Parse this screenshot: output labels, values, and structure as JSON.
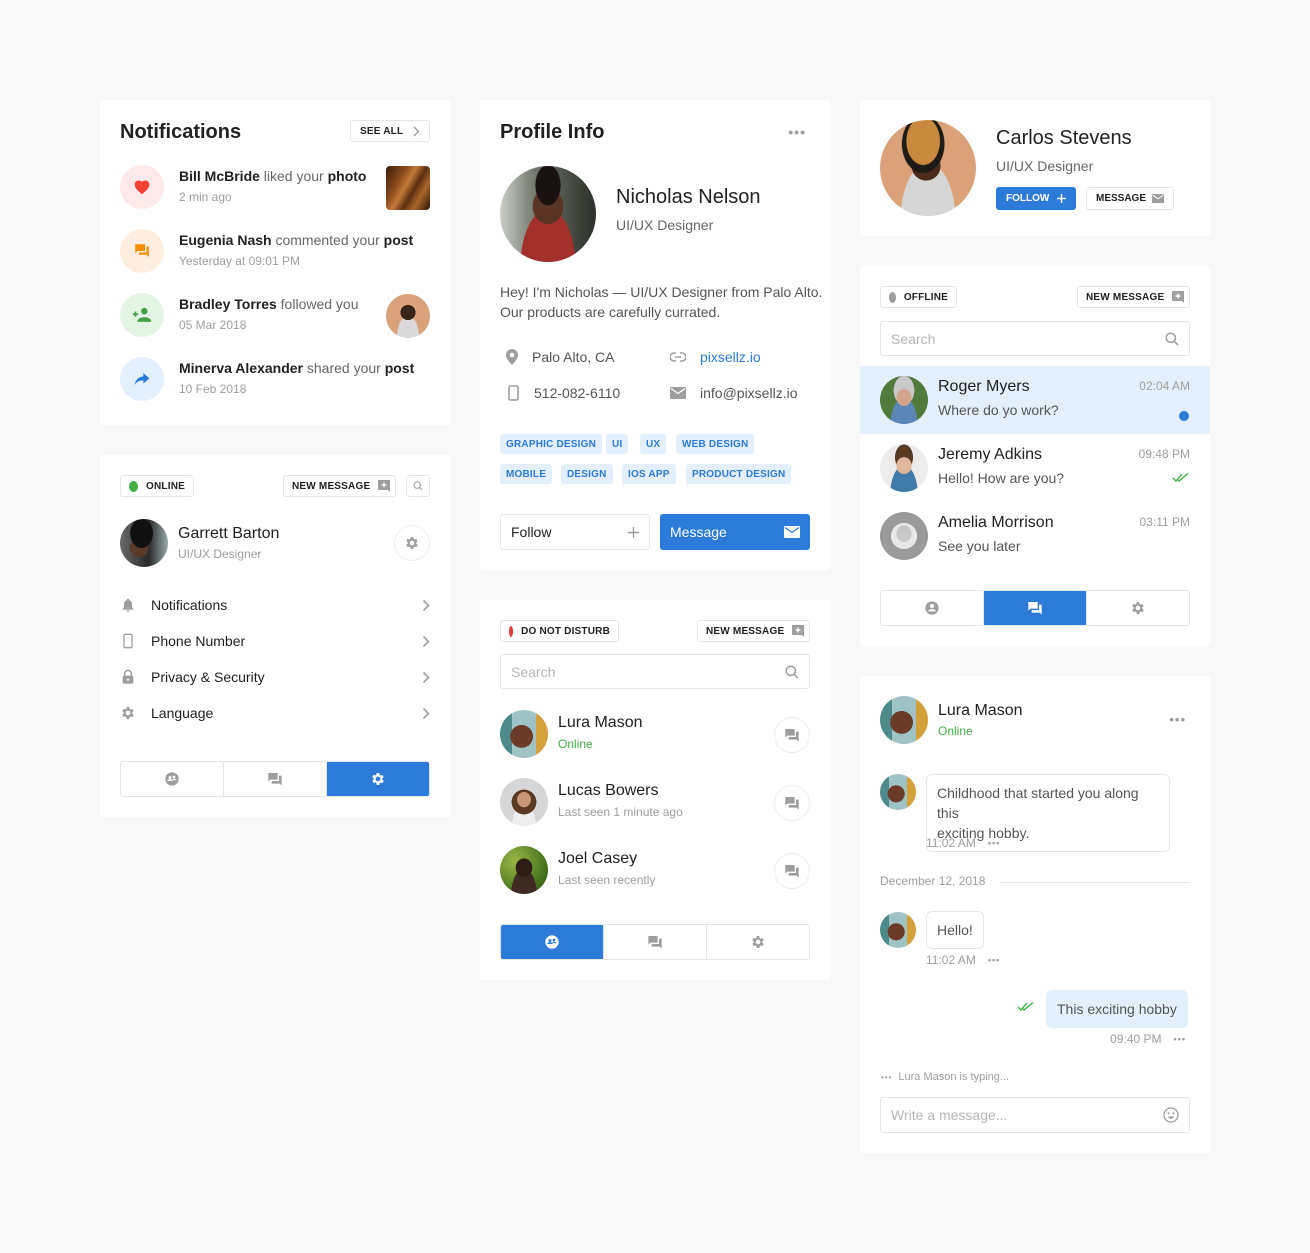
{
  "colors": {
    "accent": "#2d7bd9",
    "online": "#43b047",
    "dnd": "#e53935",
    "offline": "#9e9e9e",
    "like": "#f44336",
    "comment": "#fb8c00",
    "follow": "#43a047",
    "share": "#2d7bd9"
  },
  "notifications": {
    "title": "Notifications",
    "see_all": "SEE ALL",
    "items": [
      {
        "icon": "heart-icon",
        "name": "Bill McBride",
        "action": "liked your",
        "object": "photo",
        "time": "2 min ago",
        "thumb": "photo-thumbnail"
      },
      {
        "icon": "comment-icon",
        "name": "Eugenia Nash",
        "action": "commented your",
        "object": "post",
        "time": "Yesterday at 09:01 PM"
      },
      {
        "icon": "person-add-icon",
        "name": "Bradley Torres",
        "action": "followed you",
        "object": "",
        "time": "05 Mar 2018",
        "thumb": "avatar"
      },
      {
        "icon": "share-icon",
        "name": "Minerva Alexander",
        "action": "shared your",
        "object": "post",
        "time": "10 Feb 2018"
      }
    ]
  },
  "settings_card": {
    "status": "ONLINE",
    "new_message": "NEW MESSAGE",
    "user": {
      "name": "Garrett Barton",
      "role": "UI/UX Designer"
    },
    "menu": [
      {
        "icon": "bell-icon",
        "label": "Notifications"
      },
      {
        "icon": "phone-icon",
        "label": "Phone Number"
      },
      {
        "icon": "lock-icon",
        "label": "Privacy & Security"
      },
      {
        "icon": "gear-icon",
        "label": "Language"
      }
    ],
    "tabs": [
      "contacts",
      "chats",
      "settings"
    ],
    "active_tab": "settings"
  },
  "profile": {
    "title": "Profile Info",
    "name": "Nicholas Nelson",
    "role": "UI/UX Designer",
    "bio_line1": "Hey! I'm Nicholas — UI/UX Designer from Palo Alto.",
    "bio_line2": "Our products are carefully currated.",
    "location": "Palo Alto, CA",
    "website": "pixsellz.io",
    "phone": "512-082-6110",
    "email": "info@pixsellz.io",
    "tags": [
      "GRAPHIC DESIGN",
      "UI",
      "UX",
      "WEB DESIGN",
      "MOBILE",
      "DESIGN",
      "IOS APP",
      "PRODUCT DESIGN"
    ],
    "follow": "Follow",
    "message": "Message"
  },
  "contacts_card": {
    "status": "DO NOT DISTURB",
    "new_message": "NEW MESSAGE",
    "search_placeholder": "Search",
    "contacts": [
      {
        "name": "Lura Mason",
        "status": "Online",
        "online": true
      },
      {
        "name": "Lucas Bowers",
        "status": "Last seen 1 minute ago",
        "online": false
      },
      {
        "name": "Joel Casey",
        "status": "Last seen recently",
        "online": false
      }
    ],
    "active_tab": "contacts"
  },
  "carlos": {
    "name": "Carlos Stevens",
    "role": "UI/UX Designer",
    "follow": "FOLLOW",
    "message": "MESSAGE"
  },
  "chats_card": {
    "status": "OFFLINE",
    "new_message": "NEW MESSAGE",
    "search_placeholder": "Search",
    "conversations": [
      {
        "name": "Roger Myers",
        "message": "Where do yo work?",
        "time": "02:04 AM",
        "state": "unread"
      },
      {
        "name": "Jeremy Adkins",
        "message": "Hello! How are you?",
        "time": "09:48 PM",
        "state": "read"
      },
      {
        "name": "Amelia Morrison",
        "message": "See you later",
        "time": "03:11 PM",
        "state": "none"
      }
    ],
    "active_tab": "chats"
  },
  "chat": {
    "name": "Lura Mason",
    "status": "Online",
    "messages": [
      {
        "from": "them",
        "line1": "Childhood that started you along this",
        "line2": "exciting hobby.",
        "time": "11:02 AM"
      },
      {
        "from": "them",
        "text": "Hello!",
        "time": "11:02 AM"
      },
      {
        "from": "me",
        "text": "This exciting hobby",
        "time": "09:40 PM"
      }
    ],
    "date_divider": "December 12, 2018",
    "typing": "Lura Mason is typing...",
    "input_placeholder": "Write a message..."
  }
}
